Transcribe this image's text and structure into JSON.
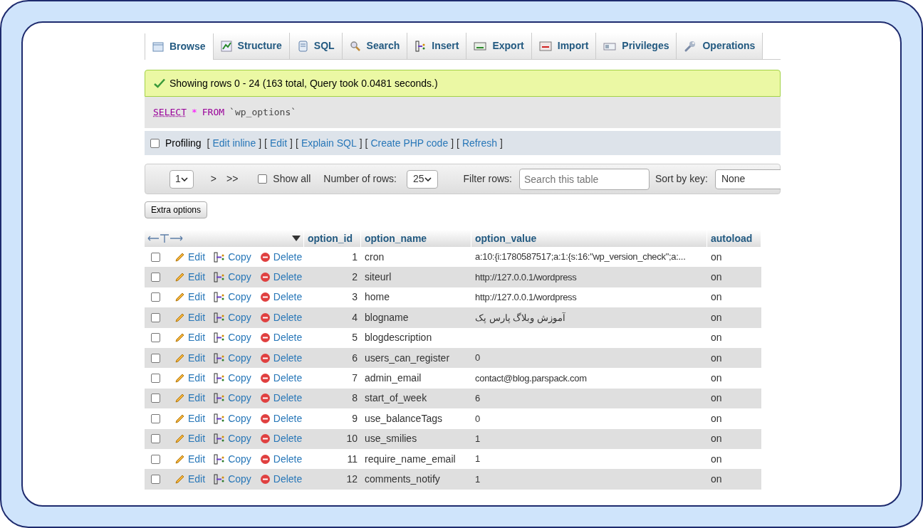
{
  "tabs": [
    {
      "label": "Browse",
      "selected": true
    },
    {
      "label": "Structure",
      "selected": false
    },
    {
      "label": "SQL",
      "selected": false
    },
    {
      "label": "Search",
      "selected": false
    },
    {
      "label": "Insert",
      "selected": false
    },
    {
      "label": "Export",
      "selected": false
    },
    {
      "label": "Import",
      "selected": false
    },
    {
      "label": "Privileges",
      "selected": false
    },
    {
      "label": "Operations",
      "selected": false
    }
  ],
  "message": "Showing rows 0 - 24 (163 total, Query took 0.0481 seconds.)",
  "query": {
    "keyword1": "SELECT",
    "star": "*",
    "keyword2": "FROM",
    "table": "`wp_options`"
  },
  "profiling": {
    "label": "Profiling",
    "checked": false,
    "links": [
      {
        "open": "[",
        "label": "Edit inline",
        "close": "]"
      },
      {
        "open": "[",
        "label": "Edit",
        "close": "]"
      },
      {
        "open": "[",
        "label": "Explain SQL",
        "close": "]"
      },
      {
        "open": "[",
        "label": "Create PHP code",
        "close": "]"
      },
      {
        "open": "[",
        "label": "Refresh",
        "close": "]"
      }
    ]
  },
  "navigation": {
    "page": "1",
    "next": ">",
    "last": ">>",
    "show_all": {
      "label": "Show all",
      "checked": false
    },
    "rows_label": "Number of rows:",
    "rows_value": "25",
    "filter_label": "Filter rows:",
    "filter_placeholder": "Search this table",
    "sort_label": "Sort by key:",
    "sort_value": "None"
  },
  "extra_options": "Extra options",
  "table": {
    "columns": [
      "option_id",
      "option_name",
      "option_value",
      "autoload"
    ],
    "rows": [
      {
        "checked": false,
        "actions": [
          "Edit",
          "Copy",
          "Delete"
        ],
        "cells": [
          "1",
          "cron",
          "a:10:{i:1780587517;a:1:{s:16:\"wp_version_check\";a:...",
          "on"
        ]
      },
      {
        "checked": false,
        "actions": [
          "Edit",
          "Copy",
          "Delete"
        ],
        "cells": [
          "2",
          "siteurl",
          "http://127.0.0.1/wordpress",
          "on"
        ]
      },
      {
        "checked": false,
        "actions": [
          "Edit",
          "Copy",
          "Delete"
        ],
        "cells": [
          "3",
          "home",
          "http://127.0.0.1/wordpress",
          "on"
        ]
      },
      {
        "checked": false,
        "actions": [
          "Edit",
          "Copy",
          "Delete"
        ],
        "cells": [
          "4",
          "blogname",
          "آموزش وبلاگ پارس پک",
          "on"
        ]
      },
      {
        "checked": false,
        "actions": [
          "Edit",
          "Copy",
          "Delete"
        ],
        "cells": [
          "5",
          "blogdescription",
          "",
          "on"
        ]
      },
      {
        "checked": false,
        "actions": [
          "Edit",
          "Copy",
          "Delete"
        ],
        "cells": [
          "6",
          "users_can_register",
          "0",
          "on"
        ]
      },
      {
        "checked": false,
        "actions": [
          "Edit",
          "Copy",
          "Delete"
        ],
        "cells": [
          "7",
          "admin_email",
          "contact@blog.parspack.com",
          "on"
        ]
      },
      {
        "checked": false,
        "actions": [
          "Edit",
          "Copy",
          "Delete"
        ],
        "cells": [
          "8",
          "start_of_week",
          "6",
          "on"
        ]
      },
      {
        "checked": false,
        "actions": [
          "Edit",
          "Copy",
          "Delete"
        ],
        "cells": [
          "9",
          "use_balanceTags",
          "0",
          "on"
        ]
      },
      {
        "checked": false,
        "actions": [
          "Edit",
          "Copy",
          "Delete"
        ],
        "cells": [
          "10",
          "use_smilies",
          "1",
          "on"
        ]
      },
      {
        "checked": false,
        "actions": [
          "Edit",
          "Copy",
          "Delete"
        ],
        "cells": [
          "11",
          "require_name_email",
          "1",
          "on"
        ]
      },
      {
        "checked": false,
        "actions": [
          "Edit",
          "Copy",
          "Delete"
        ],
        "cells": [
          "12",
          "comments_notify",
          "1",
          "on"
        ]
      }
    ]
  }
}
